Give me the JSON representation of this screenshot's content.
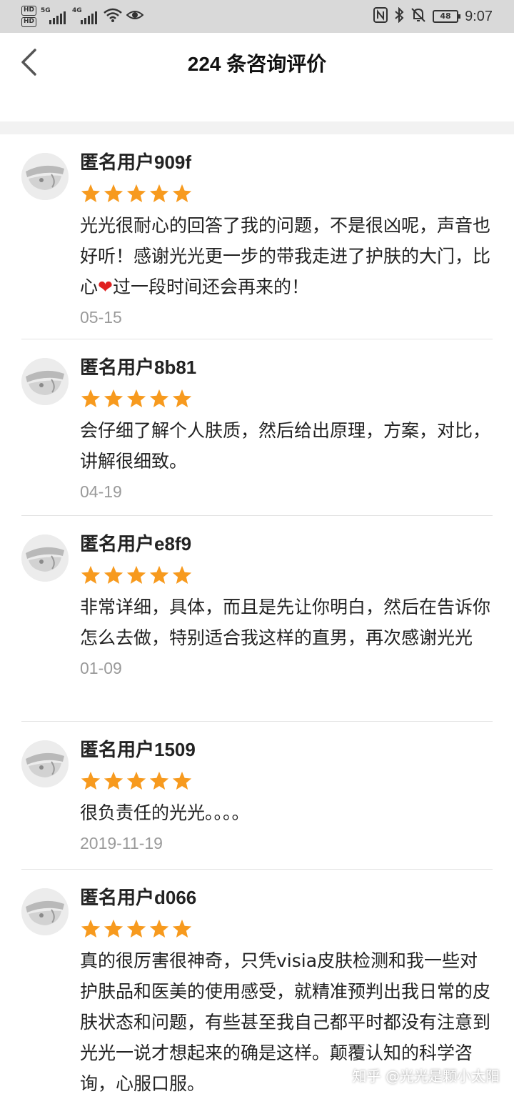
{
  "status_bar": {
    "hd_badges": [
      "HD",
      "HD"
    ],
    "signal1_label": "5G",
    "signal2_label": "4G",
    "battery": "48",
    "time": "9:07",
    "icons": [
      "wifi-icon",
      "eye-icon",
      "nfc-icon",
      "bluetooth-icon",
      "mute-bell-icon"
    ]
  },
  "header": {
    "title": "224 条咨询评价"
  },
  "colors": {
    "star": "#f79a1e",
    "date": "#9a9a9a",
    "heart": "#e02020"
  },
  "reviews": [
    {
      "name": "匿名用户909f",
      "rating": 5,
      "text_before": "光光很耐心的回答了我的问题，不是很凶呢，声音也好听！感谢光光更一步的带我走进了护肤的大门，比心",
      "emoji": "❤",
      "text_after": "过一段时间还会再来的！",
      "date": "05-15"
    },
    {
      "name": "匿名用户8b81",
      "rating": 5,
      "text": "会仔细了解个人肤质，然后给出原理，方案，对比，讲解很细致。",
      "date": "04-19"
    },
    {
      "name": "匿名用户e8f9",
      "rating": 5,
      "text": "非常详细，具体，而且是先让你明白，然后在告诉你怎么去做，特别适合我这样的直男，再次感谢光光",
      "date": "01-09"
    },
    {
      "name": "匿名用户1509",
      "rating": 5,
      "text": "很负责任的光光。。。。",
      "date": "2019-11-19"
    },
    {
      "name": "匿名用户d066",
      "rating": 5,
      "text": "真的很厉害很神奇，只凭visia皮肤检测和我一些对护肤品和医美的使用感受，就精准预判出我日常的皮肤状态和问题，有些甚至我自己都平时都没有注意到光光一说才想起来的确是这样。颠覆认知的科学咨询，心服口服。",
      "date": ""
    }
  ],
  "watermark": "知乎 @光光是颗小太阳"
}
